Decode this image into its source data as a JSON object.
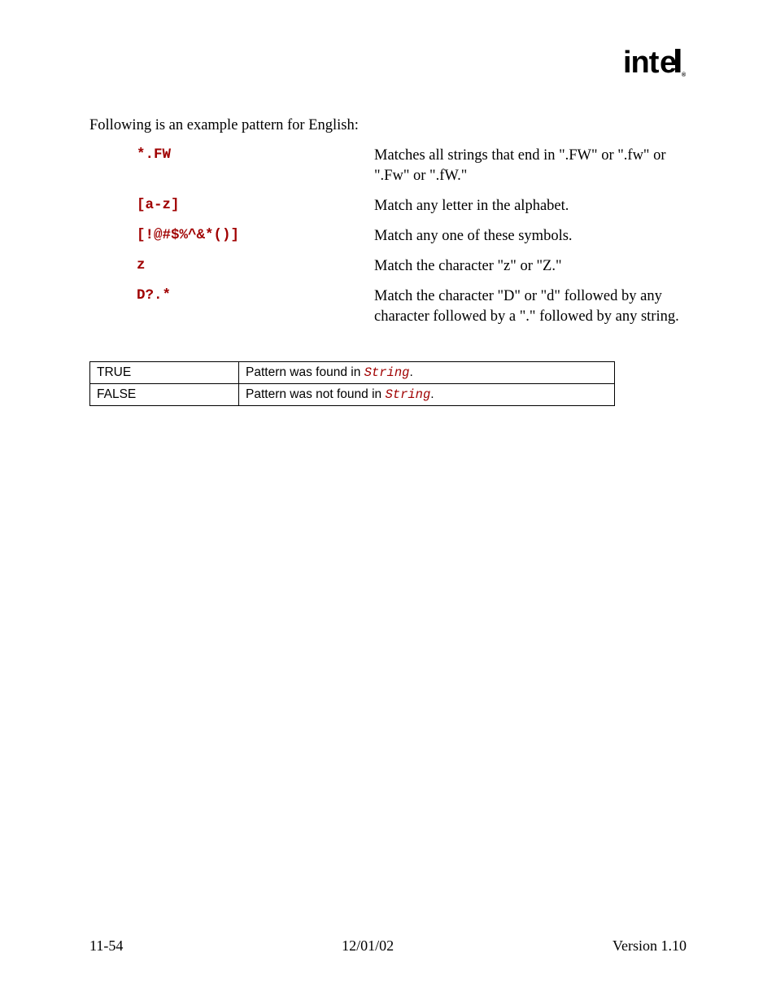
{
  "logo": {
    "text": "intel",
    "mark": "®"
  },
  "intro": "Following is an example pattern for English:",
  "patterns": [
    {
      "code": "*.FW",
      "desc": "Matches all strings that end in \".FW\" or \".fw\" or \".Fw\" or \".fW.\""
    },
    {
      "code": "[a-z]",
      "desc": "Match any letter in the alphabet."
    },
    {
      "code": "[!@#$%^&*()]",
      "desc": "Match any one of these symbols."
    },
    {
      "code": "z",
      "desc": "Match the character \"z\" or \"Z.\""
    },
    {
      "code": "D?.*",
      "desc": "Match the character \"D\" or \"d\" followed by any character followed by a \".\" followed by any string."
    }
  ],
  "results": [
    {
      "label": "TRUE",
      "desc_prefix": "Pattern was found in ",
      "code": "String",
      "desc_suffix": "."
    },
    {
      "label": "FALSE",
      "desc_prefix": "Pattern was not found in ",
      "code": "String",
      "desc_suffix": "."
    }
  ],
  "footer": {
    "left": "11-54",
    "center": "12/01/02",
    "right": "Version 1.10"
  }
}
